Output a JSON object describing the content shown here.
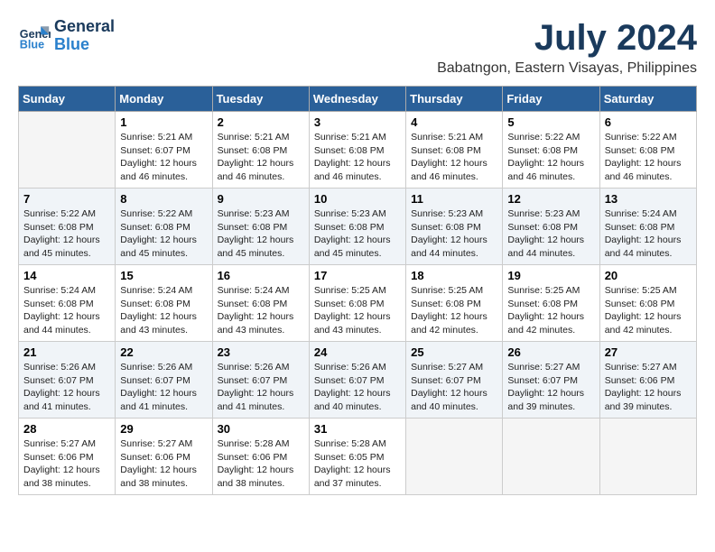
{
  "header": {
    "logo_line1": "General",
    "logo_line2": "Blue",
    "month": "July 2024",
    "location": "Babatngon, Eastern Visayas, Philippines"
  },
  "days_of_week": [
    "Sunday",
    "Monday",
    "Tuesday",
    "Wednesday",
    "Thursday",
    "Friday",
    "Saturday"
  ],
  "weeks": [
    [
      {
        "day": "",
        "info": ""
      },
      {
        "day": "1",
        "info": "Sunrise: 5:21 AM\nSunset: 6:07 PM\nDaylight: 12 hours\nand 46 minutes."
      },
      {
        "day": "2",
        "info": "Sunrise: 5:21 AM\nSunset: 6:08 PM\nDaylight: 12 hours\nand 46 minutes."
      },
      {
        "day": "3",
        "info": "Sunrise: 5:21 AM\nSunset: 6:08 PM\nDaylight: 12 hours\nand 46 minutes."
      },
      {
        "day": "4",
        "info": "Sunrise: 5:21 AM\nSunset: 6:08 PM\nDaylight: 12 hours\nand 46 minutes."
      },
      {
        "day": "5",
        "info": "Sunrise: 5:22 AM\nSunset: 6:08 PM\nDaylight: 12 hours\nand 46 minutes."
      },
      {
        "day": "6",
        "info": "Sunrise: 5:22 AM\nSunset: 6:08 PM\nDaylight: 12 hours\nand 46 minutes."
      }
    ],
    [
      {
        "day": "7",
        "info": "Sunrise: 5:22 AM\nSunset: 6:08 PM\nDaylight: 12 hours\nand 45 minutes."
      },
      {
        "day": "8",
        "info": "Sunrise: 5:22 AM\nSunset: 6:08 PM\nDaylight: 12 hours\nand 45 minutes."
      },
      {
        "day": "9",
        "info": "Sunrise: 5:23 AM\nSunset: 6:08 PM\nDaylight: 12 hours\nand 45 minutes."
      },
      {
        "day": "10",
        "info": "Sunrise: 5:23 AM\nSunset: 6:08 PM\nDaylight: 12 hours\nand 45 minutes."
      },
      {
        "day": "11",
        "info": "Sunrise: 5:23 AM\nSunset: 6:08 PM\nDaylight: 12 hours\nand 44 minutes."
      },
      {
        "day": "12",
        "info": "Sunrise: 5:23 AM\nSunset: 6:08 PM\nDaylight: 12 hours\nand 44 minutes."
      },
      {
        "day": "13",
        "info": "Sunrise: 5:24 AM\nSunset: 6:08 PM\nDaylight: 12 hours\nand 44 minutes."
      }
    ],
    [
      {
        "day": "14",
        "info": "Sunrise: 5:24 AM\nSunset: 6:08 PM\nDaylight: 12 hours\nand 44 minutes."
      },
      {
        "day": "15",
        "info": "Sunrise: 5:24 AM\nSunset: 6:08 PM\nDaylight: 12 hours\nand 43 minutes."
      },
      {
        "day": "16",
        "info": "Sunrise: 5:24 AM\nSunset: 6:08 PM\nDaylight: 12 hours\nand 43 minutes."
      },
      {
        "day": "17",
        "info": "Sunrise: 5:25 AM\nSunset: 6:08 PM\nDaylight: 12 hours\nand 43 minutes."
      },
      {
        "day": "18",
        "info": "Sunrise: 5:25 AM\nSunset: 6:08 PM\nDaylight: 12 hours\nand 42 minutes."
      },
      {
        "day": "19",
        "info": "Sunrise: 5:25 AM\nSunset: 6:08 PM\nDaylight: 12 hours\nand 42 minutes."
      },
      {
        "day": "20",
        "info": "Sunrise: 5:25 AM\nSunset: 6:08 PM\nDaylight: 12 hours\nand 42 minutes."
      }
    ],
    [
      {
        "day": "21",
        "info": "Sunrise: 5:26 AM\nSunset: 6:07 PM\nDaylight: 12 hours\nand 41 minutes."
      },
      {
        "day": "22",
        "info": "Sunrise: 5:26 AM\nSunset: 6:07 PM\nDaylight: 12 hours\nand 41 minutes."
      },
      {
        "day": "23",
        "info": "Sunrise: 5:26 AM\nSunset: 6:07 PM\nDaylight: 12 hours\nand 41 minutes."
      },
      {
        "day": "24",
        "info": "Sunrise: 5:26 AM\nSunset: 6:07 PM\nDaylight: 12 hours\nand 40 minutes."
      },
      {
        "day": "25",
        "info": "Sunrise: 5:27 AM\nSunset: 6:07 PM\nDaylight: 12 hours\nand 40 minutes."
      },
      {
        "day": "26",
        "info": "Sunrise: 5:27 AM\nSunset: 6:07 PM\nDaylight: 12 hours\nand 39 minutes."
      },
      {
        "day": "27",
        "info": "Sunrise: 5:27 AM\nSunset: 6:06 PM\nDaylight: 12 hours\nand 39 minutes."
      }
    ],
    [
      {
        "day": "28",
        "info": "Sunrise: 5:27 AM\nSunset: 6:06 PM\nDaylight: 12 hours\nand 38 minutes."
      },
      {
        "day": "29",
        "info": "Sunrise: 5:27 AM\nSunset: 6:06 PM\nDaylight: 12 hours\nand 38 minutes."
      },
      {
        "day": "30",
        "info": "Sunrise: 5:28 AM\nSunset: 6:06 PM\nDaylight: 12 hours\nand 38 minutes."
      },
      {
        "day": "31",
        "info": "Sunrise: 5:28 AM\nSunset: 6:05 PM\nDaylight: 12 hours\nand 37 minutes."
      },
      {
        "day": "",
        "info": ""
      },
      {
        "day": "",
        "info": ""
      },
      {
        "day": "",
        "info": ""
      }
    ]
  ]
}
